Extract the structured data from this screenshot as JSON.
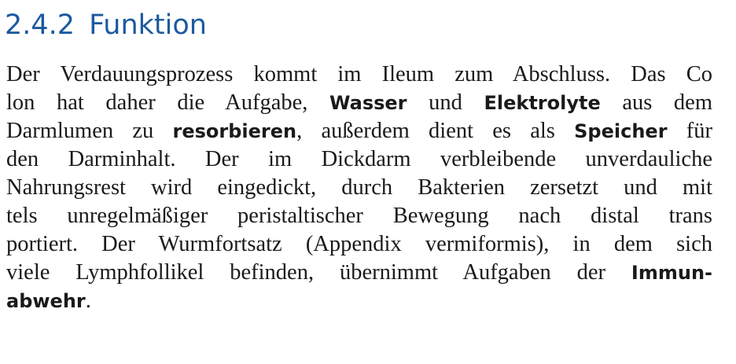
{
  "section": {
    "number": "2.4.2",
    "title": "Funktion"
  },
  "paragraph": {
    "lines": [
      [
        {
          "t": "Der Verdauungsprozess kommt im Ileum zum Abschluss. Das Co"
        }
      ],
      [
        {
          "t": "lon hat daher die Aufgabe, "
        },
        {
          "t": "Wasser",
          "b": true
        },
        {
          "t": " und "
        },
        {
          "t": "Elektrolyte",
          "b": true
        },
        {
          "t": " aus dem"
        }
      ],
      [
        {
          "t": "Darmlumen zu "
        },
        {
          "t": "resorbieren",
          "b": true
        },
        {
          "t": ", außerdem dient es als "
        },
        {
          "t": "Speicher",
          "b": true
        },
        {
          "t": " für"
        }
      ],
      [
        {
          "t": "den Darminhalt. Der im Dickdarm verbleibende unverdauliche"
        }
      ],
      [
        {
          "t": "Nahrungsrest wird eingedickt, durch Bakterien zersetzt und mit"
        }
      ],
      [
        {
          "t": "tels unregelmäßiger peristaltischer Bewegung nach distal trans"
        }
      ],
      [
        {
          "t": "portiert. Der Wurmfortsatz (Appendix vermiformis), in dem sich"
        }
      ],
      [
        {
          "t": "viele Lymphfollikel befinden, übernimmt Aufgaben der "
        },
        {
          "t": "Immun-",
          "b": true
        }
      ],
      [
        {
          "t": "abwehr",
          "b": true
        },
        {
          "t": "."
        }
      ]
    ]
  }
}
